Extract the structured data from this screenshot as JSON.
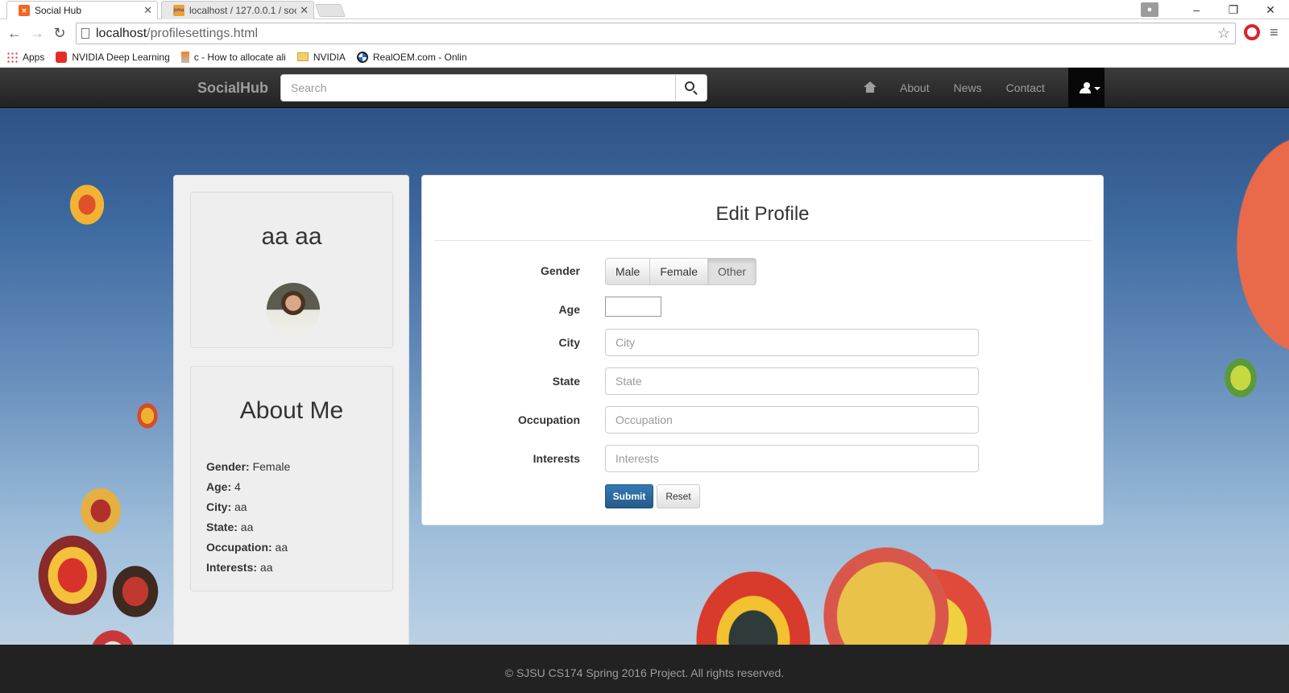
{
  "browser": {
    "tabs": [
      {
        "title": "Social Hub",
        "active": true
      },
      {
        "title": "localhost / 127.0.0.1 / soc",
        "active": false
      }
    ],
    "url_host": "localhost",
    "url_path": "/profilesettings.html",
    "bookmarks": [
      {
        "label": "Apps",
        "icon": "apps-icon"
      },
      {
        "label": "NVIDIA Deep Learning",
        "icon": "youtube-icon"
      },
      {
        "label": "c - How to allocate ali",
        "icon": "stackoverflow-icon"
      },
      {
        "label": "NVIDIA",
        "icon": "folder-icon"
      },
      {
        "label": "RealOEM.com - Onlin",
        "icon": "bmw-icon"
      }
    ],
    "window_controls": {
      "minimize": "–",
      "restore": "❐",
      "close": "✕"
    }
  },
  "navbar": {
    "brand": "SocialHub",
    "search_placeholder": "Search",
    "links": [
      "About",
      "News",
      "Contact"
    ]
  },
  "profile": {
    "name": "aa aa"
  },
  "about_me": {
    "title": "About Me",
    "rows": [
      {
        "label": "Gender:",
        "value": " Female"
      },
      {
        "label": "Age:",
        "value": " 4"
      },
      {
        "label": "City:",
        "value": " aa"
      },
      {
        "label": "State:",
        "value": " aa"
      },
      {
        "label": "Occupation:",
        "value": " aa"
      },
      {
        "label": "Interests:",
        "value": " aa"
      }
    ]
  },
  "edit_profile": {
    "title": "Edit Profile",
    "labels": {
      "gender": "Gender",
      "age": "Age",
      "city": "City",
      "state": "State",
      "occupation": "Occupation",
      "interests": "Interests"
    },
    "gender_options": [
      "Male",
      "Female",
      "Other"
    ],
    "gender_selected": "Other",
    "placeholders": {
      "city": "City",
      "state": "State",
      "occupation": "Occupation",
      "interests": "Interests"
    },
    "submit_label": "Submit",
    "reset_label": "Reset"
  },
  "footer": {
    "text": "© SJSU CS174 Spring 2016 Project. All rights reserved."
  },
  "colors": {
    "navbar": "#222222",
    "primary": "#337ab7",
    "footer": "#222222"
  }
}
